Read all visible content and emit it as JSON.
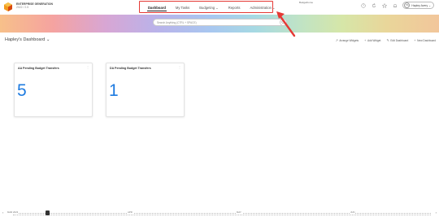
{
  "company": {
    "name": "ENTERPRISE GENERATION",
    "fy": "2022 / 2.5"
  },
  "nav": {
    "items": [
      {
        "label": "Dashboard",
        "active": true
      },
      {
        "label": "My Tasks"
      },
      {
        "label": "Budgeting ⌄"
      },
      {
        "label": "Reports"
      },
      {
        "label": "Administration ⌄"
      }
    ],
    "side_label": "Budgethome"
  },
  "user": {
    "initials": "HA",
    "name": "Hapley Avery ⌄"
  },
  "search": {
    "placeholder": "Search Anything (CTRL + SPACE)"
  },
  "dashboard": {
    "title": "Hapley's Dashboard ⌄"
  },
  "actions": [
    {
      "label": "Arrange Widgets",
      "icon": "↗"
    },
    {
      "label": "Add Widget",
      "icon": "+"
    },
    {
      "label": "Edit Dashboard",
      "icon": "✎"
    },
    {
      "label": "New Dashboard",
      "icon": "+"
    }
  ],
  "widgets": [
    {
      "title": "AA Pending Budget Transfers",
      "value": "5"
    },
    {
      "title": "DA Pending Budget Transfers",
      "value": "1"
    }
  ],
  "timeline": {
    "labels": [
      "MAR 2023",
      "APR",
      "MAY",
      "JUN"
    ]
  },
  "colors": {
    "accent": "#1e7be0",
    "highlight": "#e53935"
  }
}
